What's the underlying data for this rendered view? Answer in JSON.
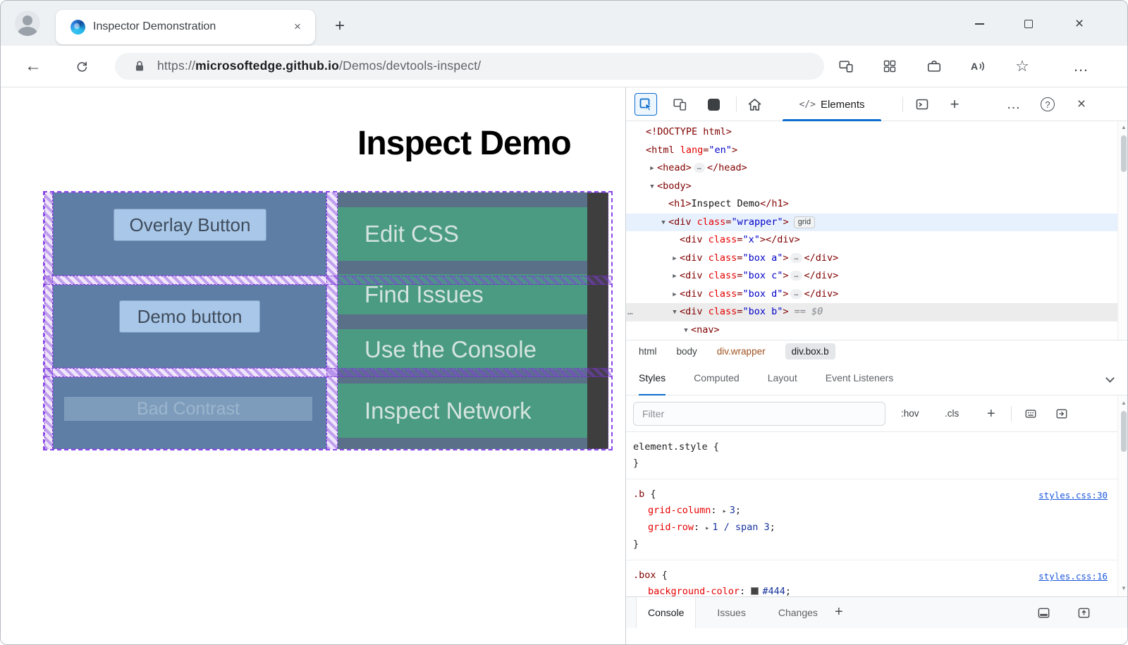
{
  "icons": {
    "back": "←",
    "ellipsis": "…",
    "more": "…",
    "help": "?",
    "close": "×",
    "add": "+",
    "arrow_expanded": "▼",
    "arrow_collapsed": "▶",
    "shorthand_arrow": "▸",
    "scroll_up": "▲",
    "scroll_down": "▼",
    "star": "☆",
    "code": "</>"
  },
  "accent_colors": {
    "edge_blue": "#0b6dce",
    "grid_overlay_purple": "#8a49ea",
    "left_box_blue": "#5f7ea6",
    "button_blue": "#a9c7e8",
    "nav_teal": "#4a9b81",
    "box_b_dark": "#3e3e3e",
    "tag_maroon": "#800000",
    "attr_red": "#e50000",
    "value_blue": "#0000c8",
    "css_link_blue": "#1a56db"
  },
  "browser": {
    "tab_title": "Inspector Demonstration",
    "url_prefix": "https://",
    "url_domain": "microsoftedge.github.io",
    "url_path": "/Demos/devtools-inspect/"
  },
  "page": {
    "heading": "Inspect Demo",
    "overlay_button_label": "Overlay Button",
    "demo_button_label": "Demo button",
    "bad_contrast_label": "Bad Contrast",
    "nav_links": [
      "Edit CSS",
      "Find Issues",
      "Use the Console",
      "Inspect Network"
    ]
  },
  "devtools": {
    "elements_tab_label": "Elements",
    "dom_lines": [
      {
        "indent": 0,
        "arrow": "none",
        "hl": "none",
        "tokens": [
          {
            "c": "t",
            "t": "<!DOCTYPE html>"
          }
        ]
      },
      {
        "indent": 0,
        "arrow": "none",
        "hl": "none",
        "tokens": [
          {
            "c": "t",
            "t": "<html"
          },
          {
            "c": "a",
            "t": " lang"
          },
          {
            "c": "t",
            "t": "="
          },
          {
            "c": "v",
            "t": "\"en\""
          },
          {
            "c": "t",
            "t": ">"
          }
        ]
      },
      {
        "indent": 1,
        "arrow": "right",
        "hl": "none",
        "tokens": [
          {
            "c": "t",
            "t": "<head>"
          },
          {
            "c": "e",
            "t": "…"
          },
          {
            "c": "t",
            "t": "</head>"
          }
        ]
      },
      {
        "indent": 1,
        "arrow": "down",
        "hl": "none",
        "tokens": [
          {
            "c": "t",
            "t": "<body>"
          }
        ]
      },
      {
        "indent": 2,
        "arrow": "none",
        "hl": "none",
        "tokens": [
          {
            "c": "t",
            "t": "<h1>"
          },
          {
            "c": "x",
            "t": "Inspect Demo"
          },
          {
            "c": "t",
            "t": "</h1>"
          }
        ]
      },
      {
        "indent": 2,
        "arrow": "down",
        "hl": "blue",
        "tokens": [
          {
            "c": "t",
            "t": "<div"
          },
          {
            "c": "a",
            "t": " class"
          },
          {
            "c": "t",
            "t": "="
          },
          {
            "c": "v",
            "t": "\"wrapper\""
          },
          {
            "c": "t",
            "t": ">"
          },
          {
            "c": "b",
            "t": "grid"
          }
        ]
      },
      {
        "indent": 3,
        "arrow": "none",
        "hl": "none",
        "tokens": [
          {
            "c": "t",
            "t": "<div"
          },
          {
            "c": "a",
            "t": " class"
          },
          {
            "c": "t",
            "t": "="
          },
          {
            "c": "v",
            "t": "\"x\""
          },
          {
            "c": "t",
            "t": ">"
          },
          {
            "c": "t",
            "t": "</div>"
          }
        ]
      },
      {
        "indent": 3,
        "arrow": "right",
        "hl": "none",
        "tokens": [
          {
            "c": "t",
            "t": "<div"
          },
          {
            "c": "a",
            "t": " class"
          },
          {
            "c": "t",
            "t": "="
          },
          {
            "c": "v",
            "t": "\"box a\""
          },
          {
            "c": "t",
            "t": ">"
          },
          {
            "c": "e",
            "t": "…"
          },
          {
            "c": "t",
            "t": "</div>"
          }
        ]
      },
      {
        "indent": 3,
        "arrow": "right",
        "hl": "none",
        "tokens": [
          {
            "c": "t",
            "t": "<div"
          },
          {
            "c": "a",
            "t": " class"
          },
          {
            "c": "t",
            "t": "="
          },
          {
            "c": "v",
            "t": "\"box c\""
          },
          {
            "c": "t",
            "t": ">"
          },
          {
            "c": "e",
            "t": "…"
          },
          {
            "c": "t",
            "t": "</div>"
          }
        ]
      },
      {
        "indent": 3,
        "arrow": "right",
        "hl": "none",
        "tokens": [
          {
            "c": "t",
            "t": "<div"
          },
          {
            "c": "a",
            "t": " class"
          },
          {
            "c": "t",
            "t": "="
          },
          {
            "c": "v",
            "t": "\"box d\""
          },
          {
            "c": "t",
            "t": ">"
          },
          {
            "c": "e",
            "t": "…"
          },
          {
            "c": "t",
            "t": "</div>"
          }
        ]
      },
      {
        "indent": 3,
        "arrow": "down",
        "hl": "gray",
        "menu": true,
        "tokens": [
          {
            "c": "t",
            "t": "<div"
          },
          {
            "c": "a",
            "t": " class"
          },
          {
            "c": "t",
            "t": "="
          },
          {
            "c": "v",
            "t": "\"box b\""
          },
          {
            "c": "t",
            "t": ">"
          },
          {
            "c": "m",
            "t": " == $0"
          }
        ]
      },
      {
        "indent": 4,
        "arrow": "down",
        "hl": "none",
        "tokens": [
          {
            "c": "t",
            "t": "<nav>"
          }
        ]
      }
    ],
    "breadcrumbs": [
      {
        "label": "html",
        "style": "plain"
      },
      {
        "label": "body",
        "style": "plain"
      },
      {
        "label": "div.wrapper",
        "style": "orange"
      },
      {
        "label": "div.box.b",
        "style": "active"
      }
    ],
    "pane_tabs": [
      {
        "label": "Styles",
        "active": true
      },
      {
        "label": "Computed",
        "active": false
      },
      {
        "label": "Layout",
        "active": false
      },
      {
        "label": "Event Listeners",
        "active": false
      }
    ],
    "filter_placeholder": "Filter",
    "pseudo_label": ":hov",
    "class_label": ".cls",
    "add_rule_label": "+",
    "style_rules": [
      {
        "selector": "element.style",
        "inline": true,
        "open": "{",
        "close": "}",
        "link": "",
        "props": []
      },
      {
        "selector": ".b",
        "open": "{",
        "close": "}",
        "link": "styles.css:30",
        "props": [
          {
            "name": "grid-column",
            "value": "3",
            "expandable": true
          },
          {
            "name": "grid-row",
            "value": "1 / span 3",
            "expandable": true
          }
        ]
      },
      {
        "selector": ".box",
        "open": "{",
        "close": "}",
        "link": "styles.css:16",
        "props": [
          {
            "name": "background-color",
            "value": "#444",
            "swatch": "#444444"
          }
        ]
      }
    ],
    "drawer_tabs": [
      {
        "label": "Console",
        "active": true
      },
      {
        "label": "Issues",
        "active": false
      },
      {
        "label": "Changes",
        "active": false
      }
    ],
    "drawer_add_label": "+"
  }
}
